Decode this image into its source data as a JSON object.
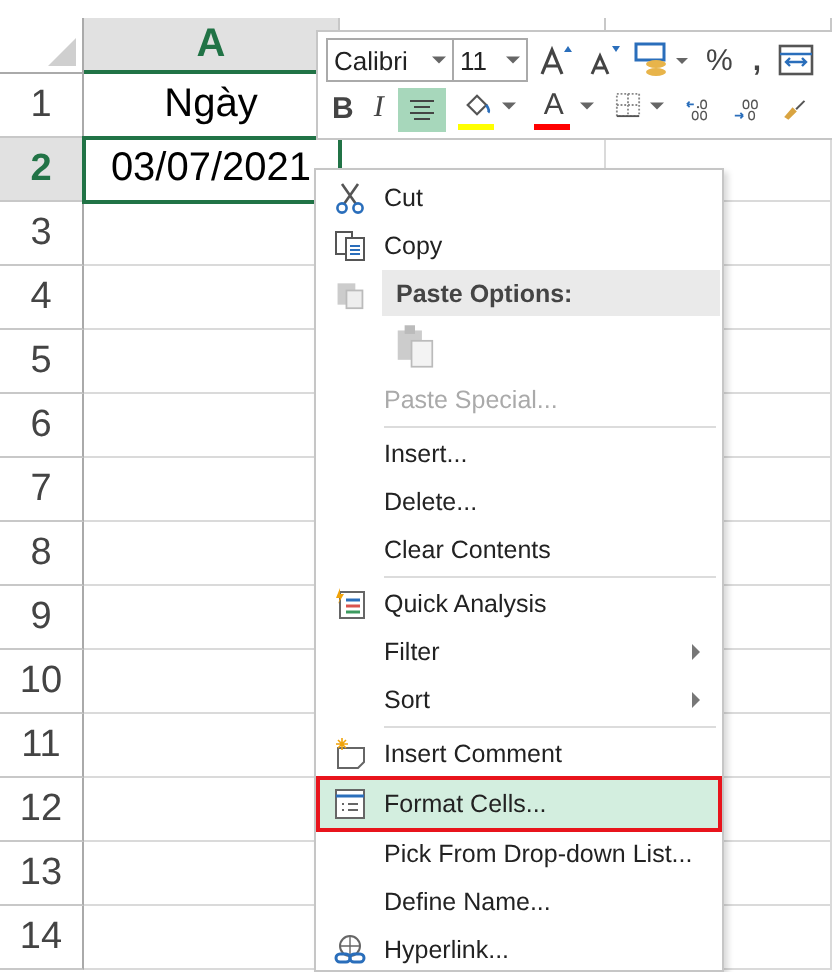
{
  "sheet": {
    "columns": [
      {
        "label": "A",
        "selected": true
      }
    ],
    "rows": [
      {
        "number": "1",
        "selected": false,
        "cells": [
          "Ngày"
        ]
      },
      {
        "number": "2",
        "selected": true,
        "cells": [
          "03/07/2021"
        ]
      },
      {
        "number": "3",
        "selected": false,
        "cells": []
      },
      {
        "number": "4",
        "selected": false,
        "cells": []
      },
      {
        "number": "5",
        "selected": false,
        "cells": []
      },
      {
        "number": "6",
        "selected": false,
        "cells": []
      },
      {
        "number": "7",
        "selected": false,
        "cells": []
      },
      {
        "number": "8",
        "selected": false,
        "cells": []
      },
      {
        "number": "9",
        "selected": false,
        "cells": []
      },
      {
        "number": "10",
        "selected": false,
        "cells": []
      },
      {
        "number": "11",
        "selected": false,
        "cells": []
      },
      {
        "number": "12",
        "selected": false,
        "cells": []
      },
      {
        "number": "13",
        "selected": false,
        "cells": []
      },
      {
        "number": "14",
        "selected": false,
        "cells": []
      }
    ]
  },
  "mini_toolbar": {
    "font": "Calibri",
    "size": "11",
    "row1": [
      {
        "kind": "grow-font"
      },
      {
        "kind": "shrink-font"
      },
      {
        "kind": "currency"
      },
      {
        "kind": "percent",
        "text": "%"
      },
      {
        "kind": "comma",
        "text": ","
      },
      {
        "kind": "format-table"
      }
    ],
    "row2": [
      {
        "kind": "bold",
        "text": "B",
        "selected": false
      },
      {
        "kind": "italic",
        "text": "I",
        "selected": false
      },
      {
        "kind": "align-center",
        "selected": true
      },
      {
        "kind": "fill-color",
        "color": "#ffff00",
        "selected": false
      },
      {
        "kind": "font-color",
        "text": "A",
        "color": "#ff0000",
        "selected": false
      },
      {
        "kind": "borders",
        "selected": false
      },
      {
        "kind": "increase-decimal",
        "selected": false
      },
      {
        "kind": "decrease-decimal",
        "selected": false
      },
      {
        "kind": "format-painter",
        "selected": false
      }
    ]
  },
  "context_menu": [
    {
      "kind": "cut",
      "label": "Cut",
      "disabled": false,
      "selected": false,
      "submenu": false,
      "outlined": false
    },
    {
      "kind": "copy",
      "label": "Copy",
      "disabled": false,
      "selected": false,
      "submenu": false,
      "outlined": false
    },
    {
      "kind": "header",
      "label": "Paste Options:"
    },
    {
      "kind": "paste-buttons"
    },
    {
      "kind": "item",
      "label": "Paste Special...",
      "disabled": true,
      "selected": false,
      "submenu": false,
      "outlined": false
    },
    {
      "kind": "separator"
    },
    {
      "kind": "item",
      "label": "Insert...",
      "disabled": false,
      "selected": false,
      "submenu": false,
      "outlined": false
    },
    {
      "kind": "item",
      "label": "Delete...",
      "disabled": false,
      "selected": false,
      "submenu": false,
      "outlined": false
    },
    {
      "kind": "item",
      "label": "Clear Contents",
      "disabled": false,
      "selected": false,
      "submenu": false,
      "outlined": false
    },
    {
      "kind": "separator"
    },
    {
      "kind": "quick-analysis",
      "label": "Quick Analysis",
      "disabled": false,
      "selected": false,
      "submenu": false,
      "outlined": false
    },
    {
      "kind": "item",
      "label": "Filter",
      "disabled": false,
      "selected": false,
      "submenu": true,
      "outlined": false
    },
    {
      "kind": "item",
      "label": "Sort",
      "disabled": false,
      "selected": false,
      "submenu": true,
      "outlined": false
    },
    {
      "kind": "separator"
    },
    {
      "kind": "comment",
      "label": "Insert Comment",
      "disabled": false,
      "selected": false,
      "submenu": false,
      "outlined": false
    },
    {
      "kind": "format-cells",
      "label": "Format Cells...",
      "disabled": false,
      "selected": true,
      "submenu": false,
      "outlined": true
    },
    {
      "kind": "item",
      "label": "Pick From Drop-down List...",
      "disabled": false,
      "selected": false,
      "submenu": false,
      "outlined": false
    },
    {
      "kind": "item",
      "label": "Define Name...",
      "disabled": false,
      "selected": false,
      "submenu": false,
      "outlined": false
    },
    {
      "kind": "hyperlink",
      "label": "Hyperlink...",
      "disabled": false,
      "selected": false,
      "submenu": false,
      "outlined": false
    }
  ]
}
